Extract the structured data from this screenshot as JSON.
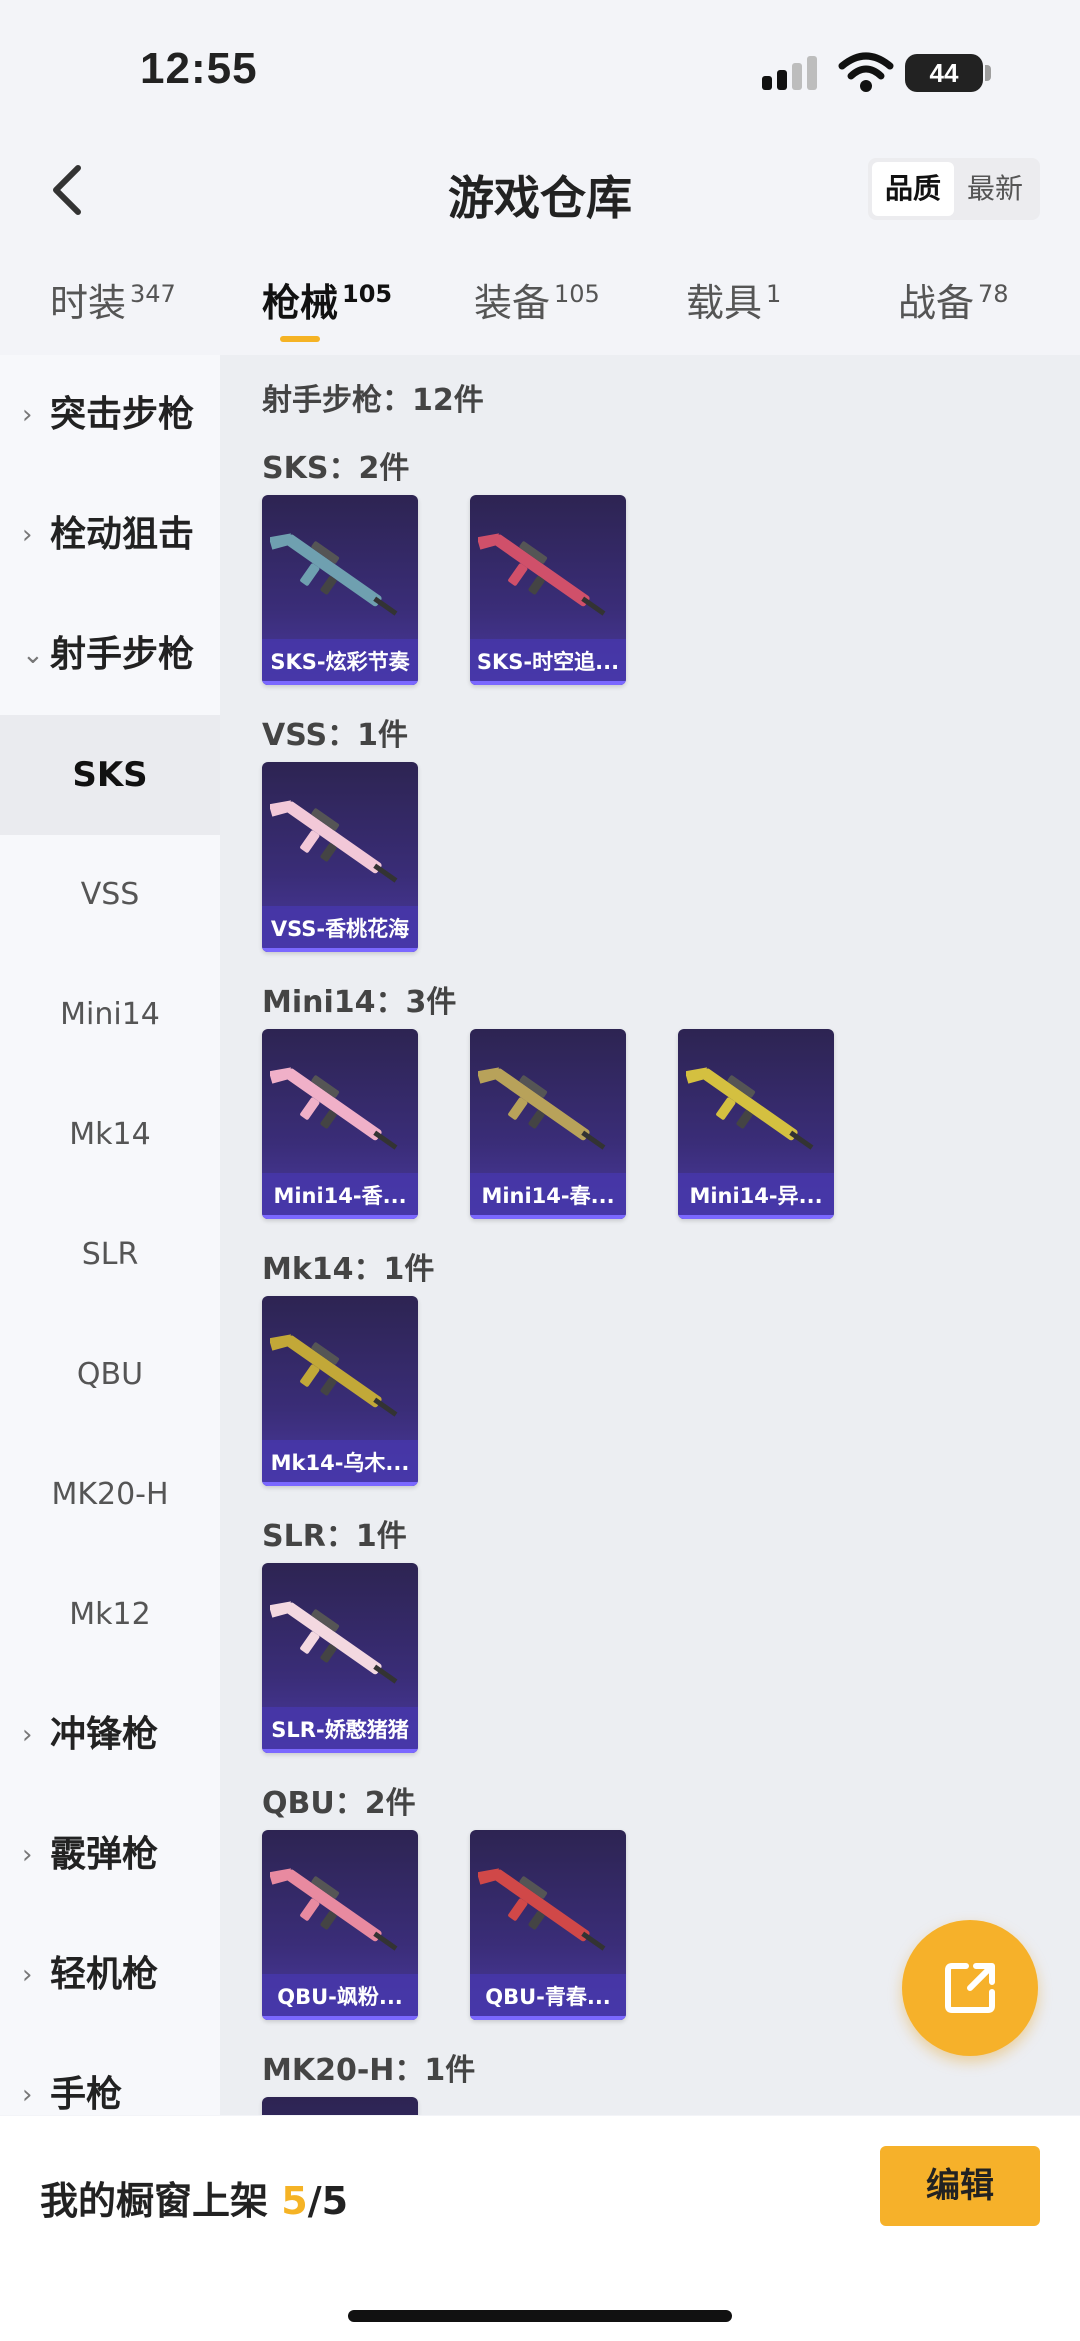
{
  "status_bar": {
    "time": "12:55",
    "battery": "44"
  },
  "header": {
    "title": "游戏仓库",
    "sort_options": [
      "品质",
      "最新"
    ],
    "sort_active": "品质"
  },
  "tabs": [
    {
      "label": "时装",
      "count": "347"
    },
    {
      "label": "枪械",
      "count": "105"
    },
    {
      "label": "装备",
      "count": "105"
    },
    {
      "label": "载具",
      "count": "1"
    },
    {
      "label": "战备",
      "count": "78"
    }
  ],
  "active_tab": "枪械",
  "sidebar": {
    "categories": [
      "突击步枪",
      "栓动狙击",
      "射手步枪",
      "冲锋枪",
      "霰弹枪",
      "轻机枪",
      "手枪"
    ],
    "subitems": [
      "SKS",
      "VSS",
      "Mini14",
      "Mk14",
      "SLR",
      "QBU",
      "MK20-H",
      "Mk12"
    ],
    "active_subitem": "SKS"
  },
  "content": {
    "category_header": "射手步枪：12件",
    "sections": [
      {
        "label": "SKS：2件",
        "items": [
          "SKS-炫彩节奏",
          "SKS-时空追..."
        ]
      },
      {
        "label": "VSS：1件",
        "items": [
          "VSS-香桃花海"
        ]
      },
      {
        "label": "Mini14：3件",
        "items": [
          "Mini14-香...",
          "Mini14-春...",
          "Mini14-异..."
        ]
      },
      {
        "label": "Mk14：1件",
        "items": [
          "Mk14-乌木..."
        ]
      },
      {
        "label": "SLR：1件",
        "items": [
          "SLR-娇憨猪猪"
        ]
      },
      {
        "label": "QBU：2件",
        "items": [
          "QBU-飒粉...",
          "QBU-青春..."
        ]
      },
      {
        "label": "MK20-H：1件",
        "items": []
      }
    ]
  },
  "gun_colors": [
    "#6fa0b0",
    "#d0506a",
    "#f2c8d8",
    "#f0b0c8",
    "#b8a25a",
    "#d4c040",
    "#c2a838",
    "#f3d8e0",
    "#e88aa0",
    "#d04848"
  ],
  "bottom_bar": {
    "shelf_label": "我的橱窗上架",
    "shelf_used": "5",
    "shelf_sep": "/",
    "shelf_total": "5",
    "edit_label": "编辑"
  }
}
